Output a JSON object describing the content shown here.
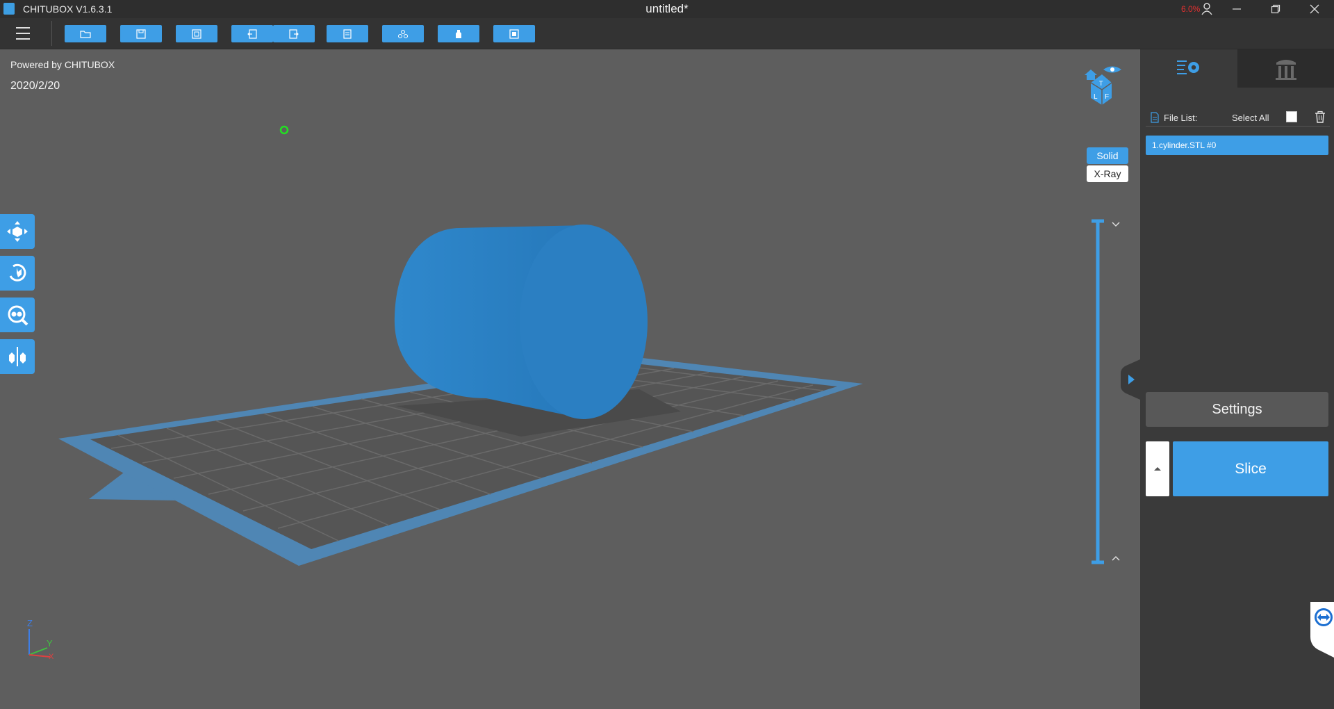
{
  "titlebar": {
    "app_title": "CHITUBOX V1.6.3.1",
    "document_title": "untitled*",
    "cpu_usage": "6.0%"
  },
  "toolbar": {
    "buttons": [
      {
        "name": "open-file",
        "icon": "folder-icon"
      },
      {
        "name": "save-file",
        "icon": "save-icon"
      },
      {
        "name": "screenshot",
        "icon": "screenshot-icon"
      },
      {
        "name": "undo",
        "icon": "undo-icon"
      },
      {
        "name": "redo",
        "icon": "redo-icon"
      },
      {
        "name": "machine-settings",
        "icon": "document-icon"
      },
      {
        "name": "auto-layout",
        "icon": "layout-icon"
      },
      {
        "name": "resin",
        "icon": "bottle-icon"
      },
      {
        "name": "print-preview",
        "icon": "square-icon"
      }
    ]
  },
  "viewport": {
    "powered_by": "Powered by CHITUBOX",
    "date": "2020/2/20",
    "view_modes": {
      "solid": "Solid",
      "xray": "X-Ray"
    },
    "axis_labels": {
      "z": "Z",
      "y": "Y",
      "x": "X"
    },
    "cube_labels": [
      "T",
      "L",
      "F"
    ]
  },
  "left_tools": [
    {
      "name": "move-tool",
      "icon": "move-icon"
    },
    {
      "name": "rotate-tool",
      "icon": "rotate-icon"
    },
    {
      "name": "scale-tool",
      "icon": "scale-icon"
    },
    {
      "name": "mirror-tool",
      "icon": "mirror-icon"
    }
  ],
  "right_panel": {
    "tabs": [
      {
        "name": "settings",
        "icon": "gear-list-icon",
        "active": true
      },
      {
        "name": "supports",
        "icon": "support-columns-icon",
        "active": false
      }
    ],
    "file_list_label": "File List:",
    "select_all_label": "Select All",
    "files": [
      "1.cylinder.STL #0"
    ],
    "settings_button": "Settings",
    "slice_button": "Slice"
  },
  "colors": {
    "accent": "#3e9ee6",
    "background": "#5e5e5e",
    "panel": "#3a3a3a",
    "titlebar": "#2e2e2e"
  }
}
